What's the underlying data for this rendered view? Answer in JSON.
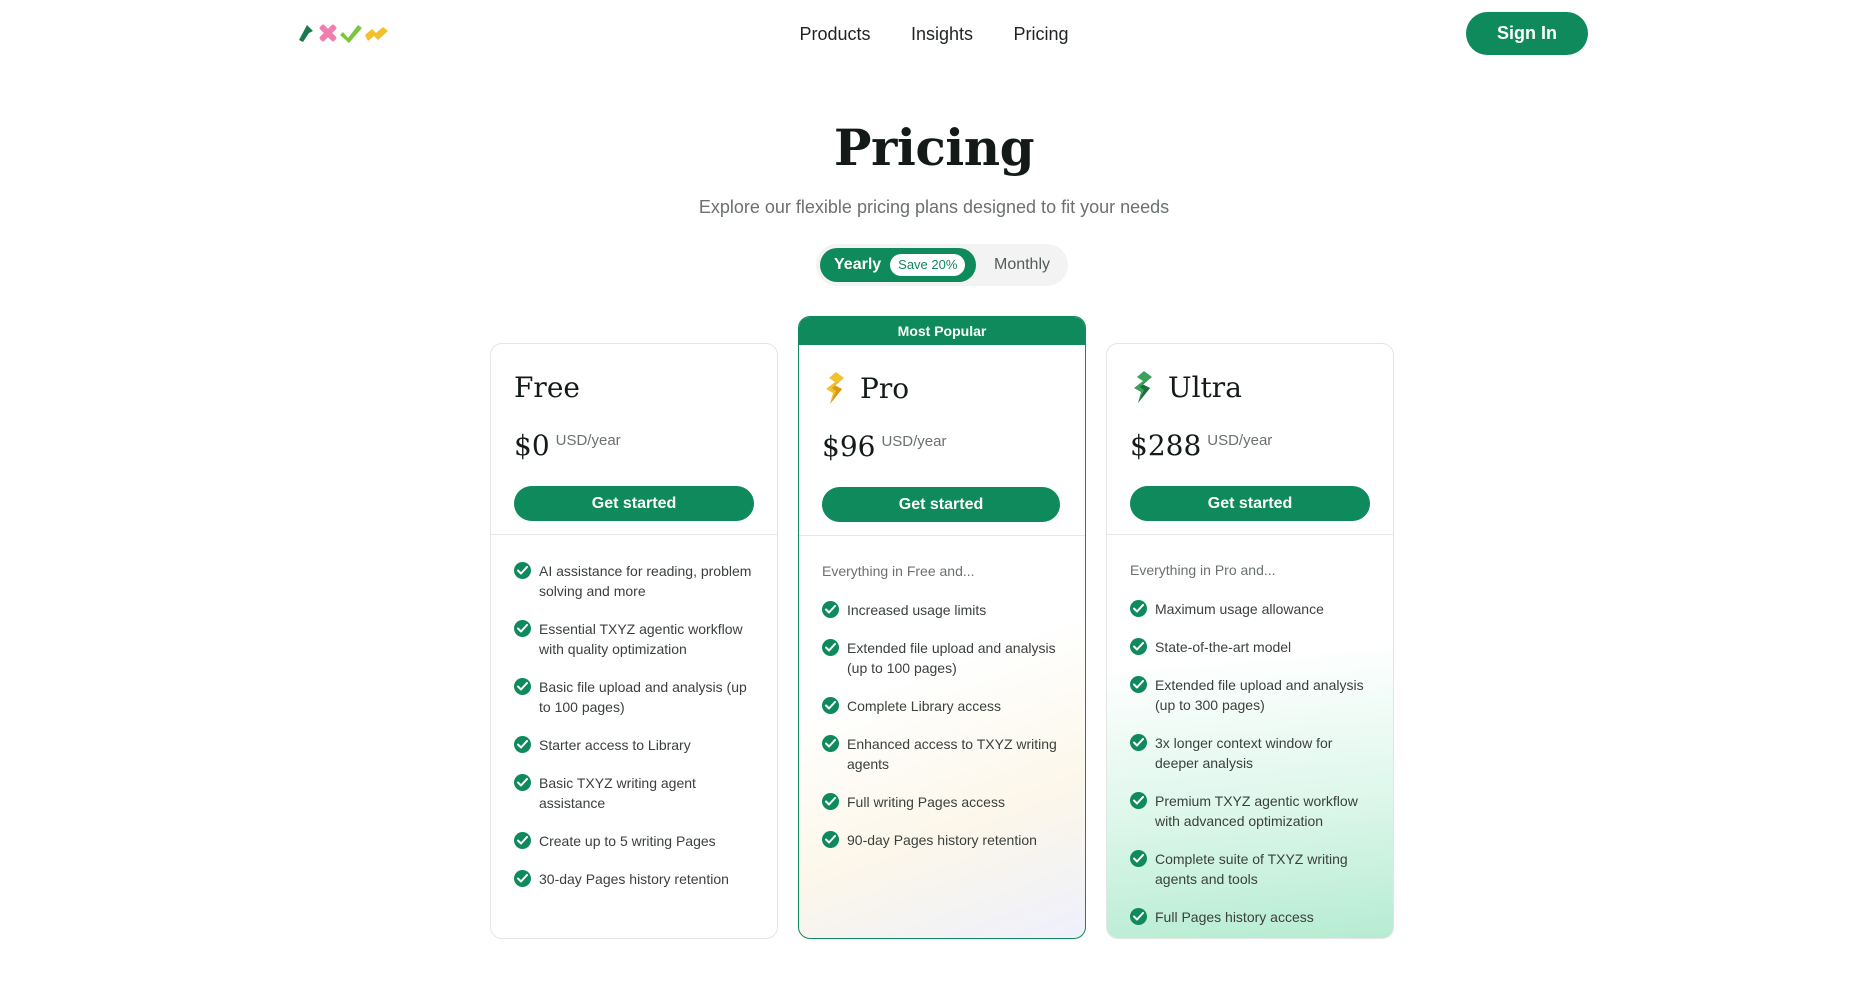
{
  "header": {
    "logo": "txyz-logo",
    "nav": [
      "Products",
      "Insights",
      "Pricing"
    ],
    "sign_in": "Sign In"
  },
  "hero": {
    "title": "Pricing",
    "subtitle": "Explore our flexible pricing plans designed to fit your needs"
  },
  "billing_toggle": {
    "yearly": "Yearly",
    "save_badge": "Save 20%",
    "monthly": "Monthly",
    "selected": "Yearly"
  },
  "plans": [
    {
      "name": "Free",
      "price": "$0",
      "unit": "USD/year",
      "button": "Get started",
      "intro": "",
      "features": [
        "AI assistance for reading, problem solving and more",
        "Essential TXYZ agentic workflow with quality optimization",
        "Basic file upload and analysis (up to 100 pages)",
        "Starter access to Library",
        "Basic TXYZ writing agent assistance",
        "Create up to 5 writing Pages",
        "30-day Pages history retention"
      ]
    },
    {
      "name": "Pro",
      "badge": "Most Popular",
      "icon": "bolt-icon",
      "price": "$96",
      "unit": "USD/year",
      "button": "Get started",
      "intro": "Everything in Free and...",
      "features": [
        "Increased usage limits",
        "Extended file upload and analysis (up to 100 pages)",
        "Complete Library access",
        "Enhanced access to TXYZ writing agents",
        "Full writing Pages access",
        "90-day Pages history retention"
      ]
    },
    {
      "name": "Ultra",
      "icon": "bolt-icon",
      "price": "$288",
      "unit": "USD/year",
      "button": "Get started",
      "intro": "Everything in Pro and...",
      "features": [
        "Maximum usage allowance",
        "State-of-the-art model",
        "Extended file upload and analysis (up to 300 pages)",
        "3x longer context window for deeper analysis",
        "Premium TXYZ agentic workflow with advanced optimization",
        "Complete suite of TXYZ writing agents and tools",
        "Full Pages history access"
      ]
    }
  ],
  "colors": {
    "brand": "#0e8a5c",
    "logo": [
      "#1a7a4c",
      "#f07fb0",
      "#7cc63e",
      "#f3bf2a"
    ],
    "pro_icon": [
      "#f3c12c",
      "#d99a10"
    ],
    "ultra_icon": [
      "#3aa35b",
      "#1d6e3b"
    ]
  }
}
